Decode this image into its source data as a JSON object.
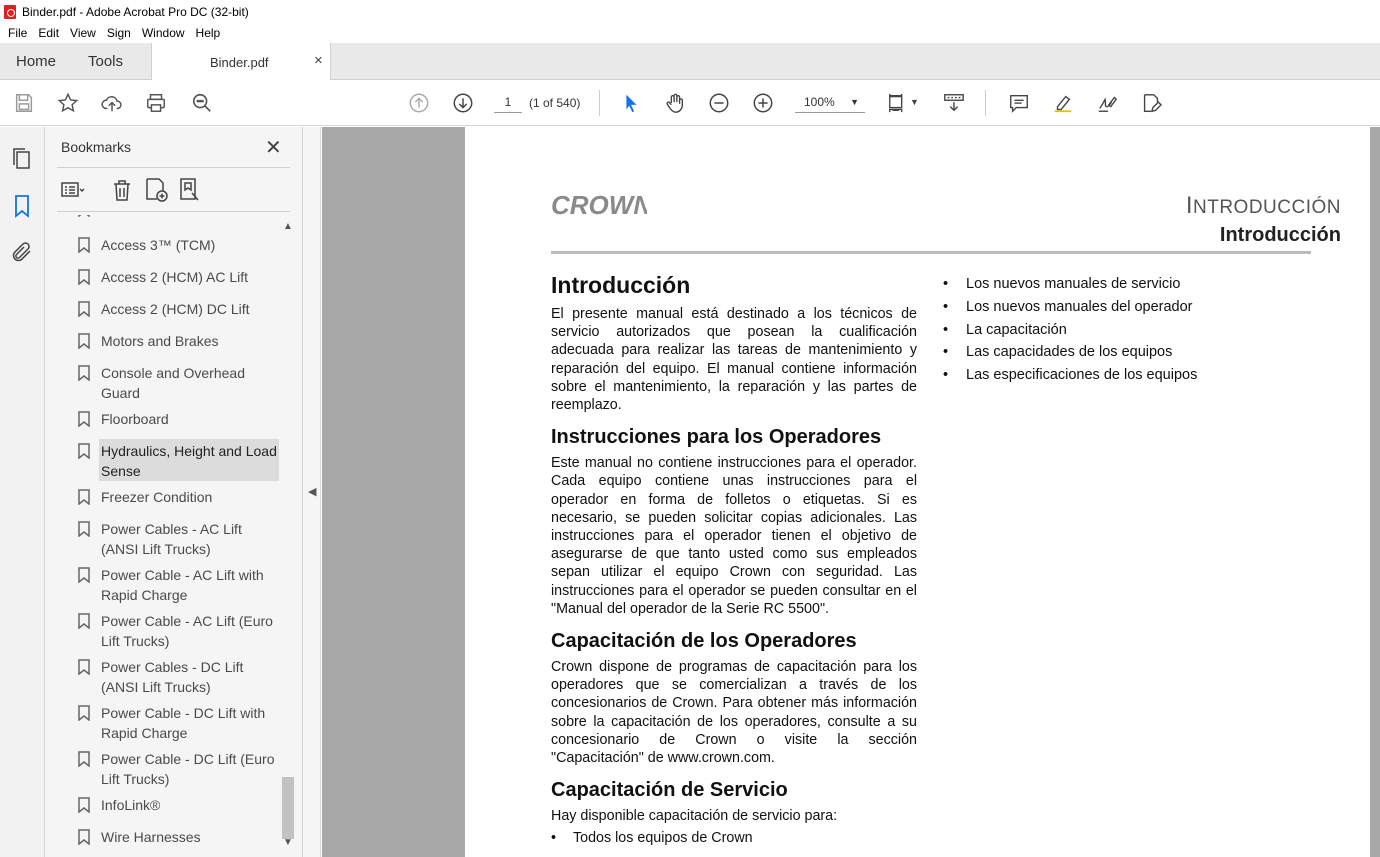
{
  "window": {
    "title": "Binder.pdf - Adobe Acrobat Pro DC (32-bit)"
  },
  "menu": [
    "File",
    "Edit",
    "View",
    "Sign",
    "Window",
    "Help"
  ],
  "tabs": {
    "home": "Home",
    "tools": "Tools",
    "document": "Binder.pdf",
    "close": "×"
  },
  "toolbar": {
    "page_number": "1",
    "page_count": "(1 of 540)",
    "zoom": "100%",
    "icons": [
      "save-icon",
      "star-icon",
      "upload-icon",
      "print-icon",
      "search-zoom-icon",
      "page-up-icon",
      "page-down-icon",
      "select-arrow-icon",
      "hand-icon",
      "zoom-out-icon",
      "zoom-in-icon",
      "fit-page-icon",
      "scroll-mode-icon",
      "comment-icon",
      "highlight-icon",
      "sign-icon",
      "edit-icon"
    ]
  },
  "bookmarks": {
    "title": "Bookmarks",
    "close": "✕",
    "items": [
      {
        "label": "Access 3™ (TCM)",
        "selected": false
      },
      {
        "label": "Access 2 (HCM) AC Lift",
        "selected": false
      },
      {
        "label": "Access 2 (HCM) DC Lift",
        "selected": false
      },
      {
        "label": "Motors and Brakes",
        "selected": false
      },
      {
        "label": "Console and Overhead Guard",
        "selected": false
      },
      {
        "label": "Floorboard",
        "selected": false
      },
      {
        "label": "Hydraulics, Height and Load Sense",
        "selected": true
      },
      {
        "label": "Freezer Condition",
        "selected": false
      },
      {
        "label": "Power Cables - AC Lift (ANSI Lift Trucks)",
        "selected": false
      },
      {
        "label": "Power Cable - AC Lift with Rapid Charge",
        "selected": false
      },
      {
        "label": "Power Cable - AC Lift (Euro Lift Trucks)",
        "selected": false
      },
      {
        "label": "Power Cables - DC Lift (ANSI Lift Trucks)",
        "selected": false
      },
      {
        "label": "Power Cable - DC Lift with Rapid Charge",
        "selected": false
      },
      {
        "label": "Power Cable - DC Lift (Euro Lift Trucks)",
        "selected": false
      },
      {
        "label": "InfoLink®",
        "selected": false
      },
      {
        "label": "Wire Harnesses",
        "selected": false
      }
    ]
  },
  "document": {
    "logo_text": "CROWN",
    "header_title_first": "I",
    "header_title_rest": "NTRODUCCIÓN",
    "header_subtitle": "Introducción",
    "sections": [
      {
        "heading": "Introducción",
        "body": "El presente manual está destinado a los técnicos de servicio autorizados que posean la cualificación adecuada para realizar las tareas de mantenimiento y reparación del equipo. El manual contiene información sobre el mantenimiento, la reparación y las partes de reemplazo."
      },
      {
        "heading": "Instrucciones para los Operadores",
        "body": "Este manual no contiene instrucciones para el operador. Cada equipo contiene unas instrucciones para el operador en forma de folletos o etiquetas. Si es necesario, se pueden solicitar copias adicionales. Las instrucciones para el operador tienen el objetivo de asegurarse de que tanto usted como sus empleados sepan utilizar el equipo Crown con seguridad. Las instrucciones para el operador se pueden consultar en el \"Manual del operador de la Serie RC 5500\"."
      },
      {
        "heading": "Capacitación de los Operadores",
        "body": "Crown dispone de programas de capacitación para los operadores que se comercializan a través de los concesionarios de Crown. Para obtener más información sobre la capacitación de los operadores, consulte a su concesionario de Crown o visite la sección \"Capacitación\" de www.crown.com."
      },
      {
        "heading": "Capacitación de Servicio",
        "body": "Hay disponible capacitación de servicio para:"
      }
    ],
    "col1_bullets": [
      "Todos los equipos de Crown"
    ],
    "col2_bullets": [
      "Los nuevos manuales de servicio",
      "Los nuevos manuales del operador",
      "La capacitación",
      "Las capacidades de los equipos",
      "Las especificaciones de los equipos"
    ]
  }
}
